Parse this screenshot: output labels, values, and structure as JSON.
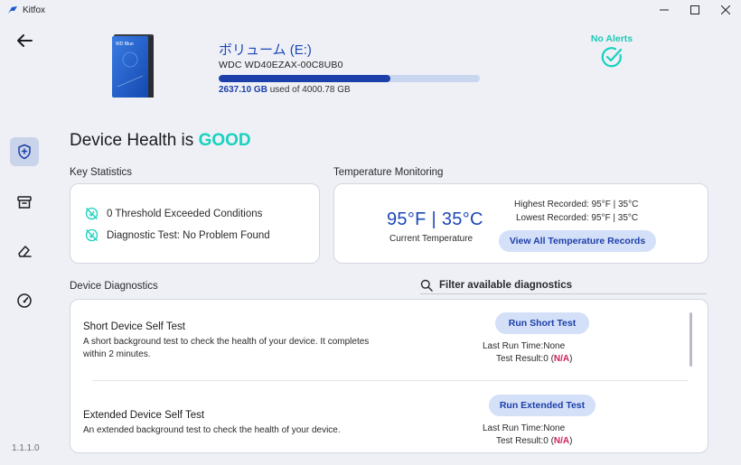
{
  "window": {
    "title": "Kitfox"
  },
  "sidebar": {
    "version": "1.1.1.0"
  },
  "device": {
    "volume_name": "ボリューム (E:)",
    "model": "WDC WD40EZAX-00C8UB0",
    "used": "2637.10 GB",
    "used_of": "used of 4000.78 GB",
    "used_fraction": 0.659,
    "drive_label": "WD Blue"
  },
  "alerts": {
    "label": "No Alerts"
  },
  "health": {
    "prefix": "Device Health is",
    "status": "GOOD"
  },
  "key_statistics": {
    "label": "Key Statistics",
    "items": [
      "0 Threshold Exceeded Conditions",
      "Diagnostic Test: No Problem Found"
    ]
  },
  "temperature": {
    "label": "Temperature Monitoring",
    "current": "95°F | 35°C",
    "caption": "Current Temperature",
    "highest": "Highest Recorded: 95°F | 35°C",
    "lowest": "Lowest Recorded: 95°F | 35°C",
    "view_button": "View All Temperature Records"
  },
  "diagnostics": {
    "label": "Device Diagnostics",
    "filter_label": "Filter available diagnostics",
    "tests": [
      {
        "title": "Short Device Self Test",
        "desc_line1": "A short background test to check the health of your device. It completes",
        "desc_line2": "within 2 minutes.",
        "button": "Run Short Test",
        "last_run": "Last Run Time:None",
        "result_prefix": "Test Result:0 (",
        "result_value": "N/A",
        "result_suffix": ")"
      },
      {
        "title": "Extended Device Self Test",
        "desc_line1": "An extended background test to check the health of your device.",
        "button": "Run Extended Test",
        "last_run": "Last Run Time:None",
        "result_prefix": "Test Result:0 (",
        "result_value": "N/A",
        "result_suffix": ")"
      }
    ]
  },
  "colors": {
    "accent": "#1d47b8",
    "good": "#17d2be",
    "na": "#d11f5a",
    "pill_bg": "#d4e0f8"
  }
}
